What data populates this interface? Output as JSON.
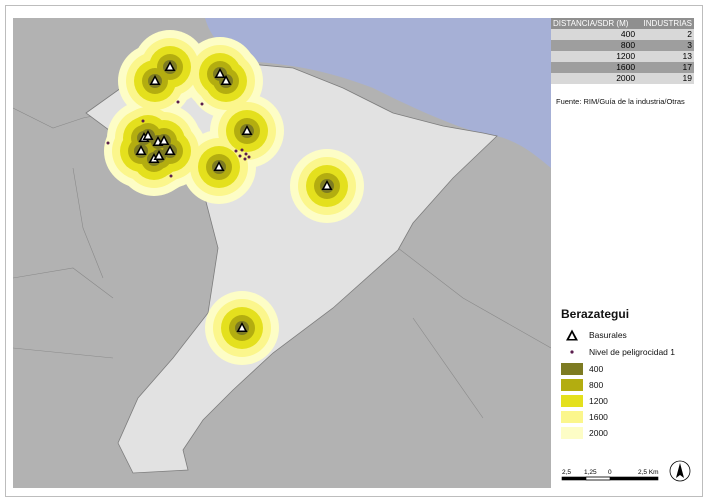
{
  "map": {
    "colors": {
      "water": "#a6b0d6",
      "outside_land": "#b2b2b2",
      "district": "#e2e2e2",
      "boundary": "#8a8a8a",
      "dot": "#5a1d4d"
    }
  },
  "buffers": {
    "rings": [
      {
        "distance": 2000,
        "color": "#fdfdc6"
      },
      {
        "distance": 1600,
        "color": "#fbf68c"
      },
      {
        "distance": 1200,
        "color": "#e4e01d"
      },
      {
        "distance": 800,
        "color": "#b3ad10"
      },
      {
        "distance": 400,
        "color": "#7d7b22"
      }
    ],
    "sites_count": 16
  },
  "table": {
    "header_distance": "DISTANCIA/SDR (M)",
    "header_industries": "INDUSTRIAS",
    "rows": [
      {
        "distance": "400",
        "industries": "2"
      },
      {
        "distance": "800",
        "industries": "3"
      },
      {
        "distance": "1200",
        "industries": "13"
      },
      {
        "distance": "1600",
        "industries": "17"
      },
      {
        "distance": "2000",
        "industries": "19"
      }
    ]
  },
  "source": "Fuente: RIM/Guía de la industria/Otras",
  "legend": {
    "title": "Berazategui",
    "basurales": "Basurales",
    "nivel": "Nivel de peligrocidad 1",
    "rings": [
      {
        "label": "400",
        "color": "#7d7b22"
      },
      {
        "label": "800",
        "color": "#b3ad10"
      },
      {
        "label": "1200",
        "color": "#e4e01d"
      },
      {
        "label": "1600",
        "color": "#fbf68c"
      },
      {
        "label": "2000",
        "color": "#fdfdc6"
      }
    ]
  },
  "scale": {
    "labels": [
      "2,5",
      "1,25",
      "0",
      "2,5 Km"
    ]
  }
}
